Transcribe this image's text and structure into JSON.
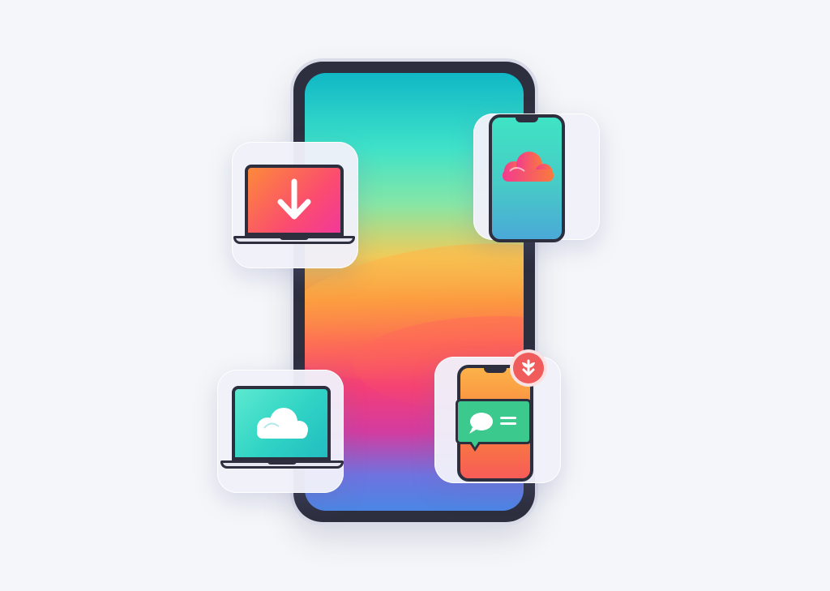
{
  "illustration": {
    "main_device": "smartphone",
    "cards": [
      {
        "id": "download",
        "device": "laptop",
        "icon": "download-arrow-icon"
      },
      {
        "id": "cloud-phone",
        "device": "phone",
        "icon": "cloud-icon"
      },
      {
        "id": "cloud-laptop",
        "device": "laptop",
        "icon": "cloud-icon"
      },
      {
        "id": "message",
        "device": "phone",
        "icon": "chat-bubble-icon"
      }
    ],
    "badge_icon": "sprout-icon"
  },
  "colors": {
    "background": "#f4f6f9",
    "device_frame": "#2d2f3f",
    "teal": "#10b7c6",
    "orange": "#fb8f3d",
    "pink": "#f33e78",
    "blue": "#4b86e4",
    "green": "#3cc98d",
    "badge_red": "#f05b5b"
  }
}
